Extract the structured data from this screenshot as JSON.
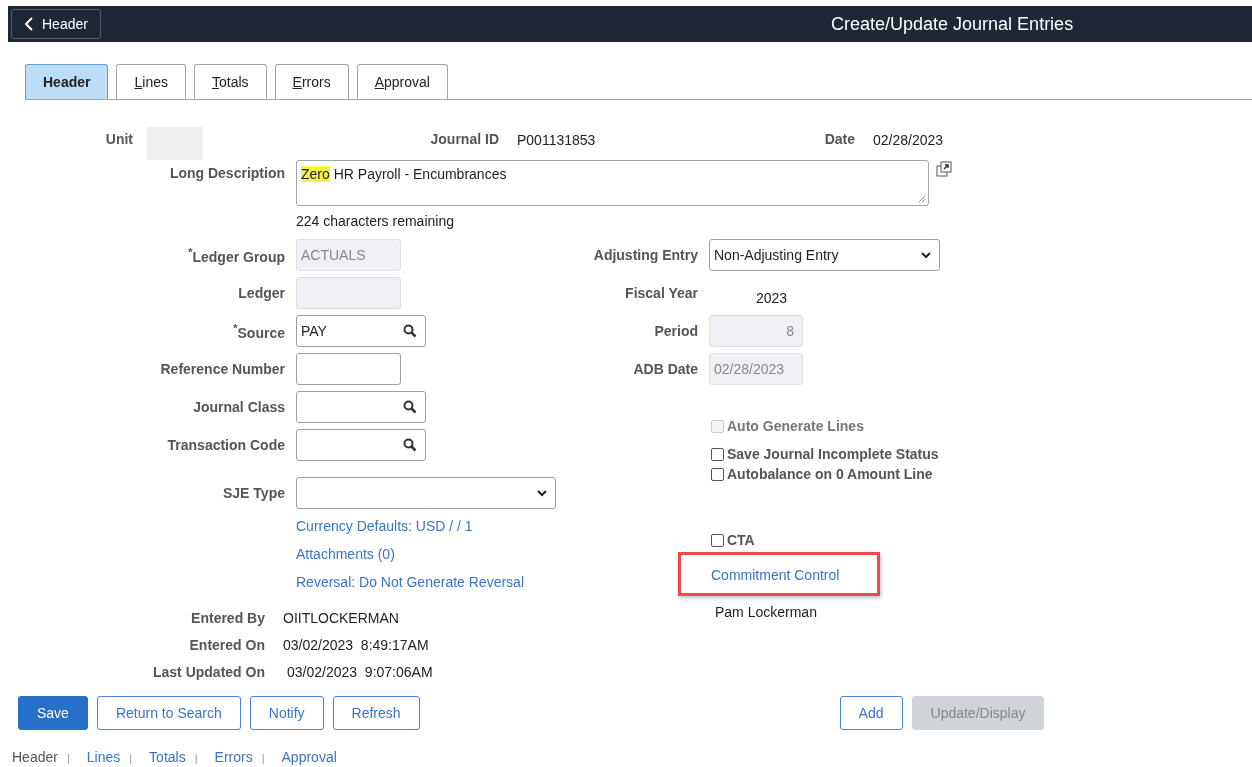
{
  "header_bar": {
    "back_button": "Header",
    "title": "Create/Update Journal Entries"
  },
  "tabs": [
    {
      "label": "Header",
      "selected": true
    },
    {
      "label": "Lines",
      "selected": false
    },
    {
      "label": "Totals",
      "selected": false
    },
    {
      "label": "Errors",
      "selected": false
    },
    {
      "label": "Approval",
      "selected": false
    }
  ],
  "top_fields": [
    {
      "label": "Unit",
      "kind": "blank"
    },
    {
      "label": "Journal ID",
      "kind": "text",
      "value": "P001131853"
    },
    {
      "label": "Date",
      "kind": "text",
      "value": "02/28/2023"
    }
  ],
  "long_description": {
    "label": "Long Description",
    "parts": [
      {
        "text": "Zero",
        "highlighted": true
      },
      {
        "text": "HR Payroll - Encumbrances",
        "highlighted": false
      }
    ],
    "remaining": "224 characters remaining"
  },
  "left_fields": [
    {
      "label": "$^{*}$Ledger Group",
      "kind": "input",
      "value": "ACTUALS",
      "disabled": true
    },
    {
      "label": "Ledger",
      "kind": "input",
      "disabled": true
    },
    {
      "label": "$^{*}$Source",
      "kind": "lookup",
      "value": "PAY",
      "disabled": false
    },
    {
      "label": "Reference Number",
      "kind": "input",
      "disabled": false
    },
    {
      "label": "Journal Class",
      "kind": "lookup",
      "disabled": false
    },
    {
      "label": "Transaction Code",
      "kind": "lookup",
      "disabled": false
    },
    {
      "label": "SJE Type",
      "kind": "select",
      "disabled": false
    }
  ],
  "left_links": [
    "Currency Defaults: USD / / 1",
    "Attachments (0)",
    "Reversal: Do Not Generate Reversal"
  ],
  "right_fields": [
    {
      "label": "Adjusting Entry",
      "kind": "select",
      "value": "Non-Adjusting Entry",
      "disabled": false
    },
    {
      "label": "Fiscal Year",
      "kind": "text",
      "value": "2023"
    },
    {
      "label": "Period",
      "kind": "input",
      "value": "8",
      "disabled": true
    },
    {
      "label": "ADB Date",
      "kind": "input",
      "value": "02/28/2023",
      "disabled": true
    }
  ],
  "options": [
    {
      "label": "Auto Generate Lines",
      "checked": false,
      "disabled": true
    },
    {
      "label": "Save Journal Incomplete Status",
      "checked": false,
      "disabled": false
    },
    {
      "label": "Autobalance on 0 Amount Line",
      "checked": false,
      "disabled": false
    }
  ],
  "cta": {
    "label": "CTA",
    "checked": false,
    "disabled": false
  },
  "commitment_control": {
    "label": "Commitment Control",
    "highlighted": true
  },
  "entered_info": [
    {
      "label": "Entered By",
      "value": "OIITLOCKERMAN"
    },
    {
      "label": "Entered On",
      "value": "03/02/2023  8:49:17AM"
    },
    {
      "label": "Last Updated On",
      "value": "03/02/2023  9:07:06AM"
    }
  ],
  "entered_by_name": "Pam Lockerman",
  "buttons": [
    {
      "label": "Save",
      "kind": "primary"
    },
    {
      "label": "Return to Search",
      "kind": "secondary"
    },
    {
      "label": "Notify",
      "kind": "secondary"
    },
    {
      "label": "Refresh",
      "kind": "secondary"
    }
  ],
  "right_buttons": [
    {
      "label": "Add",
      "kind": "secondary"
    },
    {
      "label": "Update/Display",
      "kind": "disabled"
    }
  ],
  "footer": {
    "separator": "|",
    "items": [
      {
        "label": "Header",
        "selected": true
      },
      {
        "label": "Lines",
        "selected": false
      },
      {
        "label": "Totals",
        "selected": false
      },
      {
        "label": "Errors",
        "selected": false
      },
      {
        "label": "Approval",
        "selected": false
      }
    ]
  }
}
